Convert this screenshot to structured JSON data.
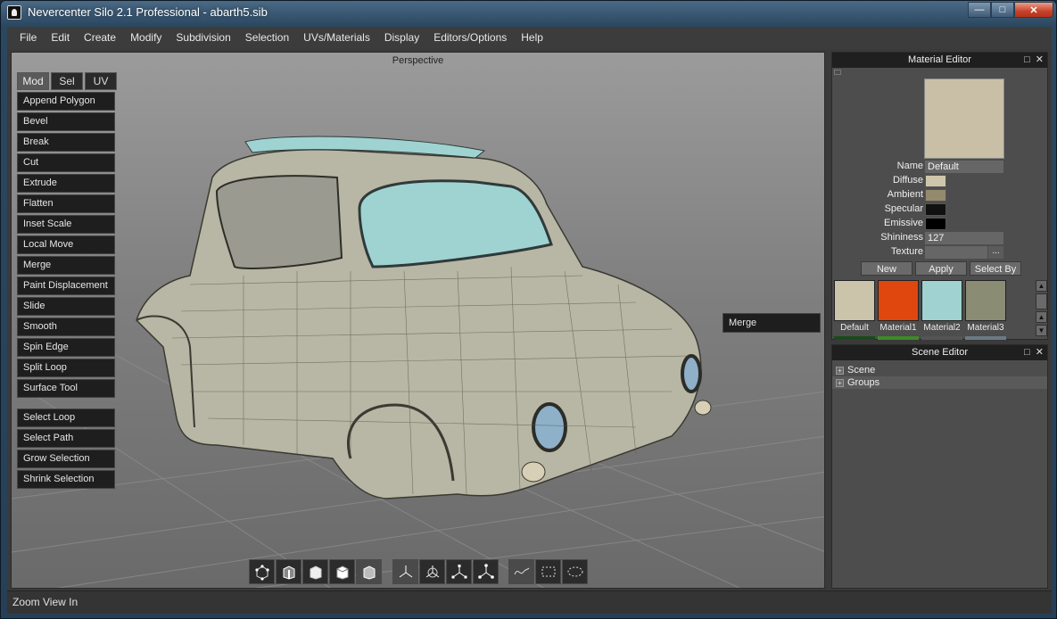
{
  "window": {
    "title": "Nevercenter Silo 2.1 Professional - abarth5.sib",
    "controls": {
      "minimize": "—",
      "maximize": "□",
      "close": "✕"
    }
  },
  "menubar": {
    "items": [
      "File",
      "Edit",
      "Create",
      "Modify",
      "Subdivision",
      "Selection",
      "UVs/Materials",
      "Display",
      "Editors/Options",
      "Help"
    ]
  },
  "viewport": {
    "label": "Perspective",
    "tabs": [
      "Mod",
      "Sel",
      "UV"
    ],
    "active_tab": "Mod",
    "modify_tools": [
      "Append Polygon",
      "Bevel",
      "Break",
      "Cut",
      "Extrude",
      "Flatten",
      "Inset Scale",
      "Local Move",
      "Merge",
      "Paint Displacement",
      "Slide",
      "Smooth",
      "Spin Edge",
      "Split Loop",
      "Surface Tool"
    ],
    "selection_tools": [
      "Select Loop",
      "Select Path",
      "Grow Selection",
      "Shrink Selection"
    ],
    "popup_button": "Merge",
    "toolbar_icons": {
      "selection_modes": [
        "vertex-mode-icon",
        "edge-mode-icon",
        "face-mode-icon",
        "object-mode-icon",
        "solid-mode-icon"
      ],
      "manipulators": [
        "move-manipulator-icon",
        "rotate-manipulator-icon",
        "scale-manipulator-icon",
        "universal-manipulator-icon"
      ],
      "select_types": [
        "paint-select-icon",
        "rect-select-icon",
        "lasso-select-icon"
      ]
    }
  },
  "status": {
    "text": "Zoom View In"
  },
  "material_editor": {
    "title": "Material Editor",
    "preview_color": "#c9bfa6",
    "properties": {
      "name_label": "Name",
      "name_value": "Default",
      "diffuse_label": "Diffuse",
      "diffuse_color": "#cfc5ab",
      "ambient_label": "Ambient",
      "ambient_color": "#948a6e",
      "specular_label": "Specular",
      "specular_color": "#111111",
      "emissive_label": "Emissive",
      "emissive_color": "#000000",
      "shininess_label": "Shininess",
      "shininess_value": "127",
      "texture_label": "Texture",
      "texture_value": "",
      "texture_browse": "..."
    },
    "buttons": [
      "New",
      "Apply",
      "Select By"
    ],
    "materials": [
      {
        "name": "Default",
        "color": "#cbc3aa"
      },
      {
        "name": "Material1",
        "color": "#e0470e"
      },
      {
        "name": "Material2",
        "color": "#9fd2d0"
      },
      {
        "name": "Material3",
        "color": "#8a8c74"
      }
    ],
    "strip_colors": [
      "#1a4a1a",
      "#3f8a28",
      "#555555",
      "#6a7a84"
    ]
  },
  "scene_editor": {
    "title": "Scene Editor",
    "items": [
      "Scene",
      "Groups"
    ]
  }
}
